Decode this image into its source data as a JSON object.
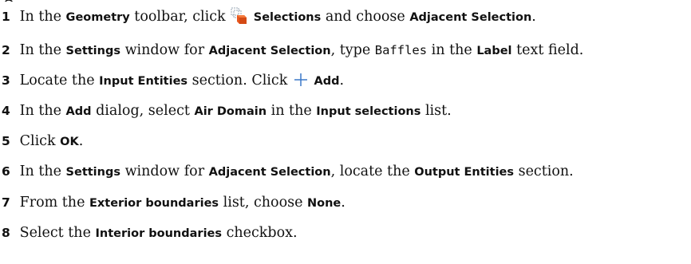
{
  "steps": [
    {
      "number": "1",
      "text_1": "In the ",
      "ui_1": "Geometry",
      "text_2": " toolbar, click ",
      "icon": "selections-icon",
      "ui_2": "Selections",
      "text_3": " and choose ",
      "ui_3": "Adjacent Selection",
      "text_4": "."
    },
    {
      "number": "2",
      "text_1": "In the ",
      "ui_1": "Settings",
      "text_2": " window for ",
      "ui_2": "Adjacent Selection",
      "text_3": ", type ",
      "code": "Baffles",
      "text_4": " in the ",
      "ui_3": "Label",
      "text_5": " text field."
    },
    {
      "number": "3",
      "text_1": "Locate the ",
      "ui_1": "Input Entities",
      "text_2": " section. Click ",
      "icon": "plus-icon",
      "ui_2": "Add",
      "text_3": "."
    },
    {
      "number": "4",
      "text_1": "In the ",
      "ui_1": "Add",
      "text_2": " dialog, select ",
      "ui_2": "Air Domain",
      "text_3": " in the ",
      "ui_3": "Input selections",
      "text_4": " list."
    },
    {
      "number": "5",
      "text_1": "Click ",
      "ui_1": "OK",
      "text_2": "."
    },
    {
      "number": "6",
      "text_1": "In the ",
      "ui_1": "Settings",
      "text_2": " window for ",
      "ui_2": "Adjacent Selection",
      "text_3": ", locate the ",
      "ui_3": "Output Entities",
      "text_4": " section."
    },
    {
      "number": "7",
      "text_1": "From the ",
      "ui_1": "Exterior boundaries",
      "text_2": " list, choose ",
      "ui_2": "None",
      "text_3": "."
    },
    {
      "number": "8",
      "text_1": "Select the ",
      "ui_1": "Interior boundaries",
      "text_2": " checkbox."
    }
  ],
  "colors": {
    "text": "#111111",
    "plus_icon": "#3a78c9",
    "selections_icon_orange": "#e8571f",
    "selections_icon_gray": "#9aa7b4"
  }
}
